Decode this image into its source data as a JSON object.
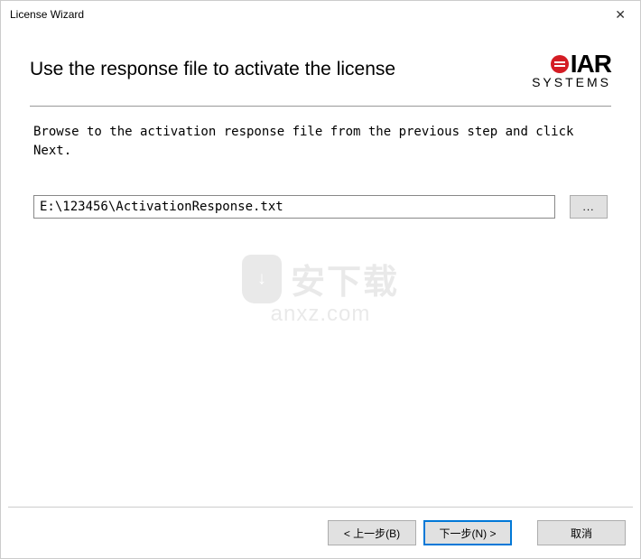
{
  "window": {
    "title": "License Wizard"
  },
  "header": {
    "heading": "Use the response file to activate the license",
    "logo_top": "IAR",
    "logo_bottom": "SYSTEMS"
  },
  "instruction": "Browse to the activation response file from the previous step and click Next.",
  "form": {
    "path_value": "E:\\123456\\ActivationResponse.txt",
    "browse_label": "..."
  },
  "watermark": {
    "text": "安下载",
    "url": "anxz.com"
  },
  "buttons": {
    "back": "< 上一步(B)",
    "next": "下一步(N) >",
    "cancel": "取消"
  }
}
